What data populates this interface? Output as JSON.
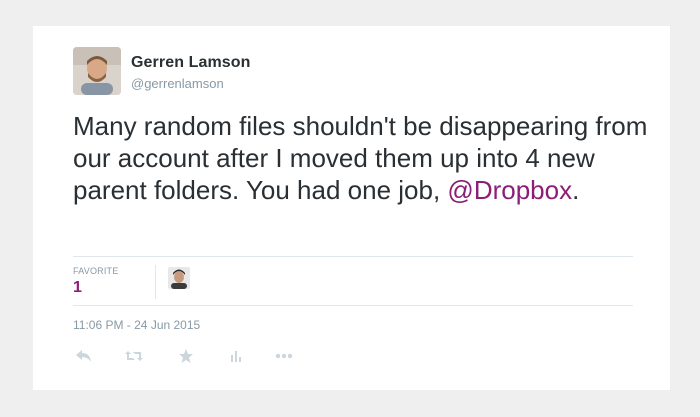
{
  "tweet": {
    "author_name": "Gerren Lamson",
    "author_handle": "@gerrenlamson",
    "text_before_mention": "Many random files shouldn't be disappearing from our account after I moved them up into 4 new parent folders. You had one job, ",
    "mention": "@Dropbox",
    "text_after_mention": ".",
    "favorite_label": "FAVORITE",
    "favorite_count": "1",
    "timestamp": "11:06 PM - 24 Jun 2015"
  },
  "actions": [
    {
      "icon": "reply-icon"
    },
    {
      "icon": "retweet-icon"
    },
    {
      "icon": "favorite-star-icon"
    },
    {
      "icon": "analytics-icon"
    },
    {
      "icon": "more-icon"
    }
  ],
  "colors": {
    "mention": "#8b1e77",
    "text": "#292f33",
    "muted": "#8899a6",
    "icon": "#ccd6dd",
    "background": "#efefef"
  }
}
